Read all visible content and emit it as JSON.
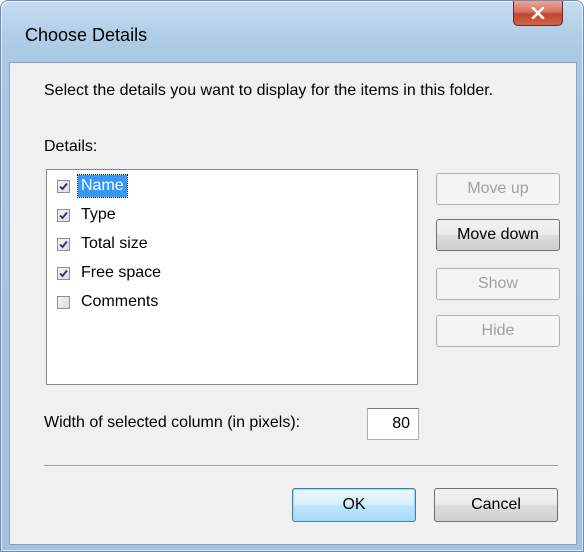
{
  "window": {
    "title": "Choose Details"
  },
  "dialog": {
    "instruction": "Select the details you want to display for the items in this folder.",
    "details_label": "Details:",
    "items": [
      {
        "label": "Name",
        "checked": true,
        "selected": true
      },
      {
        "label": "Type",
        "checked": true,
        "selected": false
      },
      {
        "label": "Total size",
        "checked": true,
        "selected": false
      },
      {
        "label": "Free space",
        "checked": true,
        "selected": false
      },
      {
        "label": "Comments",
        "checked": false,
        "selected": false
      }
    ],
    "buttons": {
      "move_up": "Move up",
      "move_down": "Move down",
      "show": "Show",
      "hide": "Hide"
    },
    "width_label": "Width of selected column (in pixels):",
    "width_value": "80",
    "ok": "OK",
    "cancel": "Cancel"
  },
  "colors": {
    "selection": "#3399ff",
    "close_button": "#c7503a"
  }
}
